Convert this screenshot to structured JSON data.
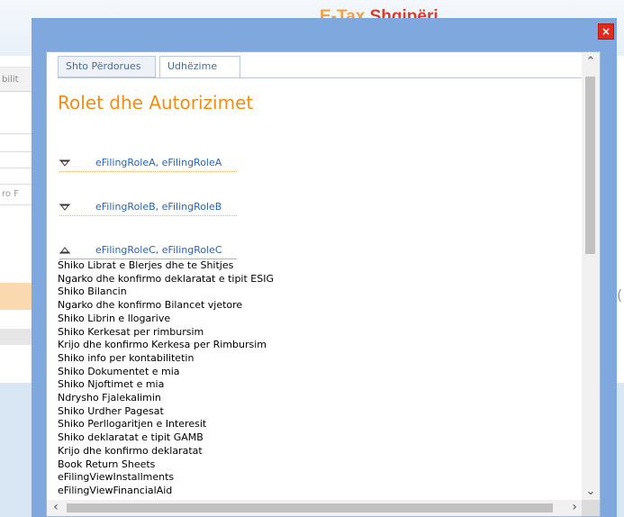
{
  "background": {
    "brand_part1": "E-Tax ",
    "brand_part2": "Shqipëri",
    "left_tab_fragment": "bilit",
    "left_input_fragment": "ro F",
    "right_fragment": "("
  },
  "modal": {
    "close_label": "×",
    "tabs": [
      {
        "label": "Shto Përdorues"
      },
      {
        "label": "Udhëzime"
      }
    ],
    "title": "Rolet dhe Autorizimet",
    "roles": [
      {
        "label": "eFilingRoleA, eFilingRoleA",
        "expanded": false
      },
      {
        "label": "eFilingRoleB, eFilingRoleB",
        "expanded": false
      },
      {
        "label": "eFilingRoleC, eFilingRoleC",
        "expanded": true
      }
    ],
    "permissions": [
      "Shiko Librat e Blerjes dhe te Shitjes",
      "Ngarko dhe konfirmo deklaratat e tipit ESIG",
      "Shiko Bilancin",
      "Ngarko dhe konfirmo Bilancet vjetore",
      "Shiko Librin e llogarive",
      "Shiko Kerkesat per rimbursim",
      "Krijo dhe konfirmo Kerkesa per Rimbursim",
      "Shiko info per kontabilitetin",
      "Shiko Dokumentet e mia",
      "Shiko Njoftimet e mia",
      "Ndrysho Fjalekalimin",
      "Shiko Urdher Pagesat",
      "Shiko Perllogaritjen e Interesit",
      "Shiko deklaratat e tipit GAMB",
      "Krijo dhe konfirmo deklaratat",
      "Book Return Sheets",
      "eFilingViewInstallments",
      "eFilingViewFinancialAid"
    ],
    "colors": {
      "overlay": "#7fa9de",
      "title": "#f28c13",
      "link": "#2a64b4",
      "close": "#e02b1b"
    }
  }
}
